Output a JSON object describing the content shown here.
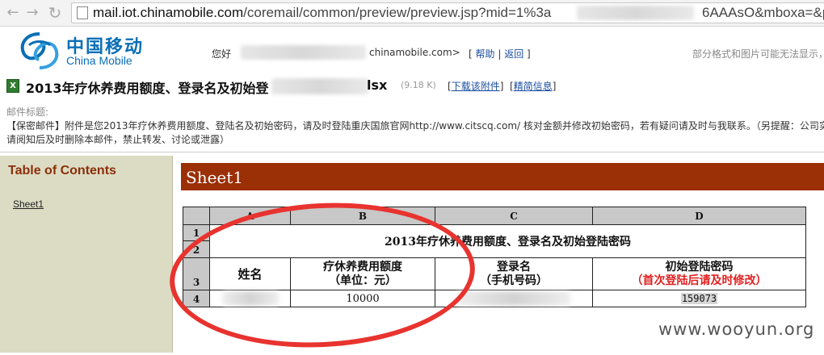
{
  "browser": {
    "url_domain": "mail.iot.chinamobile.com",
    "url_path": "/coremail/common/preview/preview.jsp?mid=1%3a",
    "url_tail": "6AAAsO&mboxa=&p"
  },
  "header": {
    "logo_cn": "中国移动",
    "logo_en": "China Mobile",
    "greeting": "您好",
    "user_domain": "chinamobile.com>",
    "help_label": "帮助",
    "back_label": "返回",
    "notice": "部分格式和图片可能无法显示，"
  },
  "attachment": {
    "name_prefix": "2013年疗休养费用额度、登录名及初始登",
    "name_suffix": "lsx",
    "size": "(9.18 K)",
    "download_label": "下载该附件",
    "more_label": "精简信息"
  },
  "mail": {
    "subject_label": "邮件标题:",
    "body_line1": "【保密邮件】附件是您2013年疗休养费用额度、登陆名及初始密码，请及时登陆重庆国旅官网http://www.citscq.com/ 核对金额并修改初始密码，若有疑问请及时与我联系。（另提醒：公司实行",
    "body_line2": "请阅知后及时删除本邮件，禁止转发、讨论或泄露）"
  },
  "toc": {
    "title": "Table of Contents",
    "items": [
      "Sheet1"
    ]
  },
  "sheet": {
    "name": "Sheet1",
    "col_headers": [
      "A",
      "B",
      "C",
      "D"
    ],
    "row_numbers": [
      "1",
      "2",
      "3",
      "4"
    ],
    "title": "2013年疗休养费用额度、登录名及初始登陆密码",
    "h_name": "姓名",
    "h_amount_1": "疗休养费用额度",
    "h_amount_2": "（单位：元）",
    "h_login_1": "登录名",
    "h_login_2": "（手机号码）",
    "h_pwd_1": "初始登陆密码",
    "h_pwd_2": "（首次登陆后请及时修改）",
    "amount": "10000",
    "password": "159073"
  },
  "watermark": "www.wooyun.org",
  "colors": {
    "brand": "#0a6fb6",
    "sheet_banner": "#9b2f06",
    "toc_bg": "#dcdcc4",
    "annotation": "#e8332f"
  }
}
